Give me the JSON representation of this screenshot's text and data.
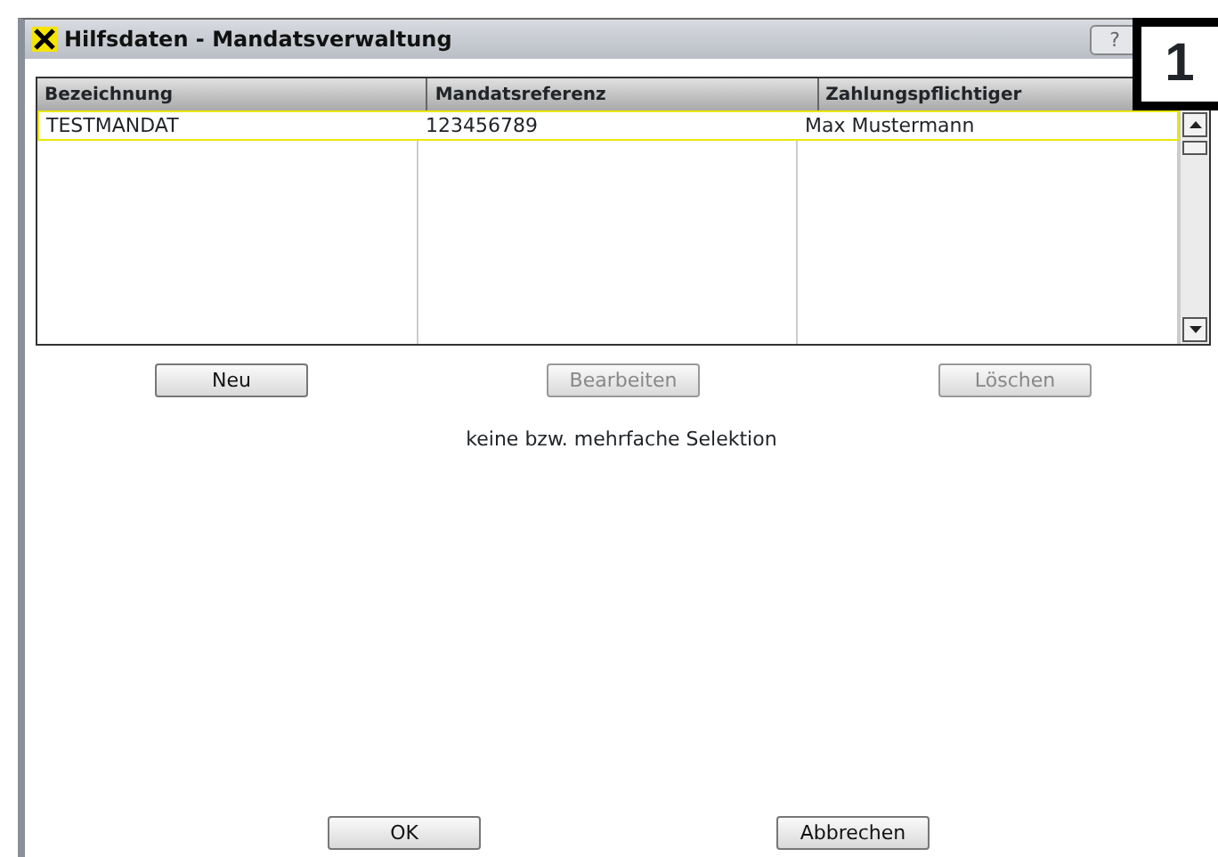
{
  "window": {
    "title": "Hilfsdaten - Mandatsverwaltung",
    "help": "?"
  },
  "callout": "1",
  "table": {
    "columns": [
      "Bezeichnung",
      "Mandatsreferenz",
      "Zahlungspflichtiger"
    ],
    "rows": [
      {
        "cells": [
          "TESTMANDAT",
          "123456789",
          "Max Mustermann"
        ],
        "selected": true
      }
    ]
  },
  "actions": [
    {
      "label": "Neu",
      "disabled": false
    },
    {
      "label": "Bearbeiten",
      "disabled": true
    },
    {
      "label": "Löschen",
      "disabled": true
    }
  ],
  "status": "keine bzw. mehrfache Selektion",
  "buttons": [
    {
      "label": "OK",
      "disabled": false
    },
    {
      "label": "Abbrechen",
      "disabled": false
    }
  ]
}
